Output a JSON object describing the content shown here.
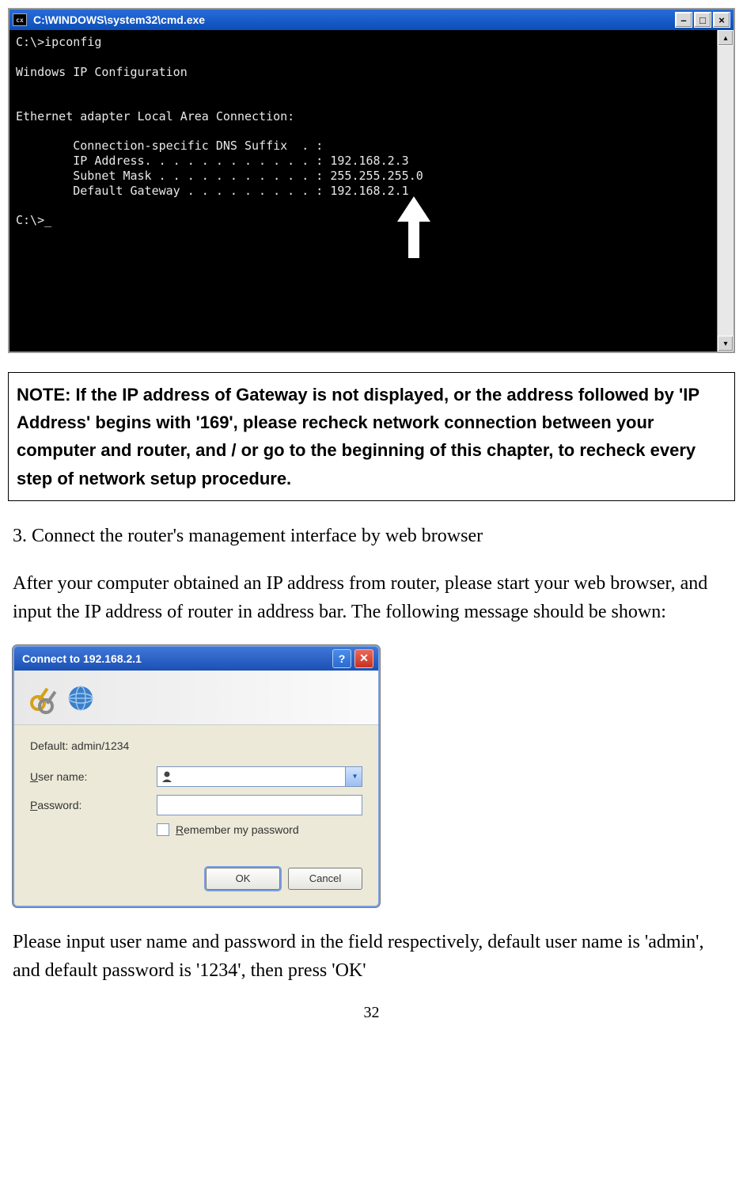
{
  "cmd": {
    "title": "C:\\WINDOWS\\system32\\cmd.exe",
    "icon_label": "cx",
    "lines": "C:\\>ipconfig\n\nWindows IP Configuration\n\n\nEthernet adapter Local Area Connection:\n\n        Connection-specific DNS Suffix  . :\n        IP Address. . . . . . . . . . . . : 192.168.2.3\n        Subnet Mask . . . . . . . . . . . : 255.255.255.0\n        Default Gateway . . . . . . . . . : 192.168.2.1\n\nC:\\>_"
  },
  "note": "NOTE: If the IP address of Gateway is not displayed, or the address followed by 'IP Address' begins with '169', please recheck network connection between your computer and router, and / or go to the beginning of this chapter, to recheck every step of network setup procedure.",
  "step_title": "3. Connect the router's management interface by web browser",
  "step_body": "After your computer obtained an IP address from router, please start your web browser, and input the IP address of router in address bar. The following message should be shown:",
  "dialog": {
    "title": "Connect to 192.168.2.1",
    "hint": "Default: admin/1234",
    "user_label": "User name:",
    "pass_label": "Password:",
    "remember": "Remember my password",
    "ok": "OK",
    "cancel": "Cancel"
  },
  "closing": "Please input user name and password in the field respectively, default user name is 'admin', and default password is '1234', then press 'OK'",
  "page_num": "32"
}
